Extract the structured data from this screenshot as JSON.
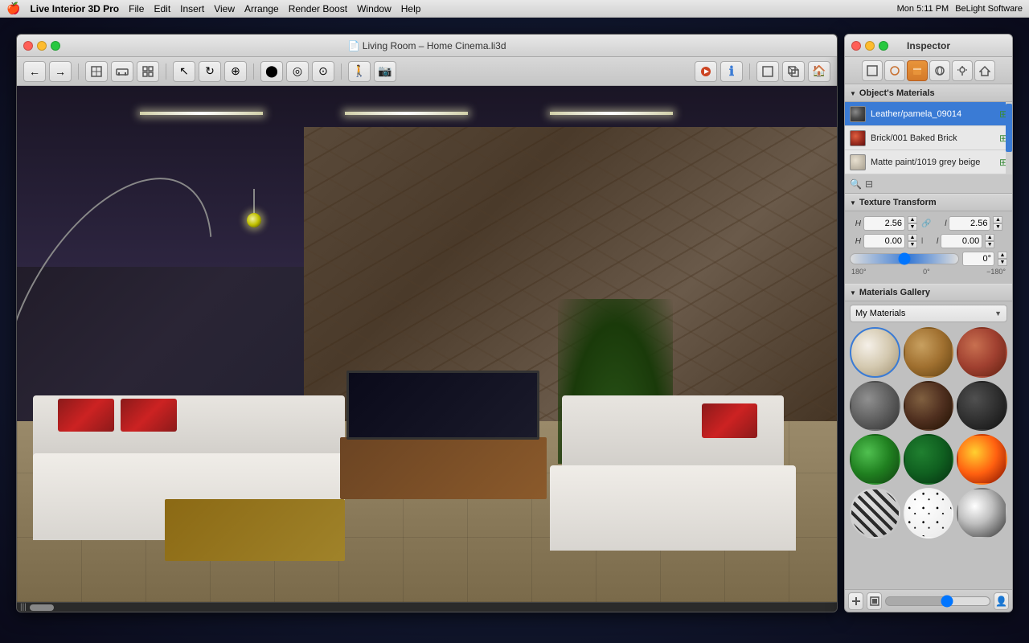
{
  "menubar": {
    "apple": "🍎",
    "items": [
      "Live Interior 3D Pro",
      "File",
      "Edit",
      "Insert",
      "View",
      "Arrange",
      "Render Boost",
      "Window",
      "Help"
    ],
    "right_items": [
      "Mon 5:11 PM",
      "BeLight Software"
    ]
  },
  "viewport_window": {
    "title": "Living Room – Home Cinema.li3d",
    "scrollbar_label": "|||"
  },
  "inspector": {
    "title": "Inspector",
    "toolbar_buttons": [
      "house-icon",
      "circle-icon",
      "pencil-icon",
      "sphere-icon",
      "light-icon",
      "home-icon"
    ],
    "objects_materials_label": "Object's Materials",
    "materials": [
      {
        "name": "Leather/pamela_09014",
        "color": "#5a5a5a",
        "selected": true
      },
      {
        "name": "Brick/001 Baked Brick",
        "color": "#cc4422"
      },
      {
        "name": "Matte paint/1019 grey beige",
        "color": "#d4c9b0"
      }
    ],
    "texture_transform": {
      "label": "Texture Transform",
      "scale_x_label": "H",
      "scale_y_label": "l",
      "offset_x_label": "H",
      "offset_y_label": "l",
      "scale_x_value": "2.56",
      "scale_y_value": "2.56",
      "offset_x_value": "0.00",
      "offset_y_value": "0.00",
      "angle_value": "0°",
      "angle_min": "180°",
      "angle_mid": "0°",
      "angle_max": "−180°"
    },
    "gallery": {
      "label": "Materials Gallery",
      "dropdown_value": "My Materials",
      "materials": [
        {
          "id": "cream",
          "class": "mat-cream",
          "selected": true
        },
        {
          "id": "wood-light",
          "class": "mat-wood-light"
        },
        {
          "id": "brick",
          "class": "mat-brick"
        },
        {
          "id": "concrete",
          "class": "mat-concrete"
        },
        {
          "id": "wood-dark",
          "class": "mat-wood-dark"
        },
        {
          "id": "dark",
          "class": "mat-dark"
        },
        {
          "id": "green",
          "class": "mat-green"
        },
        {
          "id": "green-dark",
          "class": "mat-green-dark"
        },
        {
          "id": "fire",
          "class": "mat-fire"
        },
        {
          "id": "zebra",
          "class": "mat-zebra"
        },
        {
          "id": "spots",
          "class": "mat-spots"
        },
        {
          "id": "chrome",
          "class": "mat-chrome"
        }
      ]
    }
  }
}
